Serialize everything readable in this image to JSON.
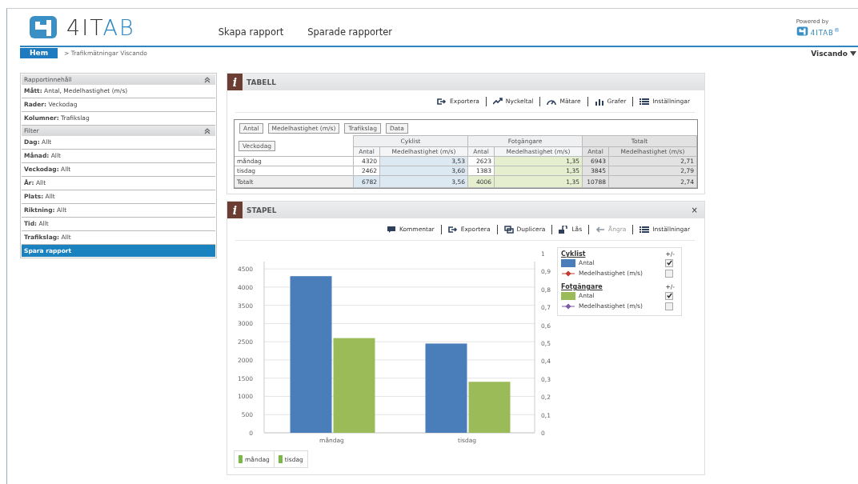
{
  "header": {
    "logo_text": [
      "4IT",
      "AB"
    ],
    "nav": [
      {
        "label": "Skapa rapport"
      },
      {
        "label": "Sparade rapporter"
      }
    ],
    "powered_by": "Powered by",
    "powered_logo": "4ITAB$^{®}$"
  },
  "breadcrumb": {
    "home": "Hem",
    "path": "> Trafikmätningar Viscando",
    "user": "Viscando"
  },
  "sidebar": {
    "sections": [
      {
        "title": "Rapportinnehåll",
        "items": [
          "**Mått:** Antal, Medelhastighet (m/s)",
          "**Rader:** Veckodag",
          "**Kolumner:** Trafikslag"
        ]
      },
      {
        "title": "Filter",
        "items": [
          "**Dag:** Allt",
          "**Månad:** Allt",
          "**Veckodag:** Allt",
          "**År:** Allt",
          "**Plats:** Allt",
          "**Riktning:** Allt",
          "**Tid:** Allt",
          "**Trafikslag:** Allt"
        ]
      }
    ],
    "save_button": "Spara rapport"
  },
  "table_panel": {
    "info_icon": "i",
    "title": "TABELL",
    "toolbar": [
      {
        "label": "Exportera",
        "kind": "export",
        "disabled": false
      },
      {
        "label": "Nyckeltal",
        "kind": "trend",
        "disabled": false
      },
      {
        "label": "Mätare",
        "kind": "gauge",
        "disabled": false
      },
      {
        "label": "Grafer",
        "kind": "bars",
        "disabled": false
      },
      {
        "label": "Inställningar",
        "kind": "list",
        "disabled": false
      }
    ],
    "chips": [
      "Antal",
      "Medelhastighet (m/s)",
      "Trafikslag",
      "Data"
    ],
    "row_chip": "Veckodag",
    "groups": [
      {
        "name": "Cyklist",
        "color": "#dce8f2",
        "columns": [
          "Antal",
          "Medelhastighet (m/s)"
        ]
      },
      {
        "name": "Fotgängare",
        "color": "#e5efcf",
        "columns": [
          "Antal",
          "Medelhastighet (m/s)"
        ]
      },
      {
        "name": "Totalt",
        "color": "#e2e2e2",
        "columns": [
          "Antal",
          "Medelhastighet (m/s)"
        ]
      }
    ],
    "rows": [
      {
        "label": "måndag",
        "kind": "data",
        "cells": [
          "4320",
          "3,53",
          "2623",
          "1,35",
          "6943",
          "2,71"
        ]
      },
      {
        "label": "tisdag",
        "kind": "data",
        "cells": [
          "2462",
          "3,60",
          "1383",
          "1,35",
          "3845",
          "2,79"
        ]
      },
      {
        "label": "Totalt",
        "kind": "total",
        "cells": [
          "6782",
          "3,56",
          "4006",
          "1,35",
          "10788",
          "2,74"
        ]
      }
    ]
  },
  "chart_panel": {
    "info_icon": "i",
    "title": "STAPEL",
    "close": "×",
    "toolbar": [
      {
        "label": "Kommentar",
        "kind": "comment",
        "disabled": false
      },
      {
        "label": "Exportera",
        "kind": "export",
        "disabled": false
      },
      {
        "label": "Duplicera",
        "kind": "duplicate",
        "disabled": false
      },
      {
        "label": "Lås",
        "kind": "lock",
        "disabled": false
      },
      {
        "label": "Ångra",
        "kind": "undo",
        "disabled": true
      },
      {
        "label": "Inställningar",
        "kind": "list",
        "disabled": false
      }
    ],
    "chart_data": {
      "type": "bar",
      "categories": [
        "måndag",
        "tisdag"
      ],
      "series": [
        {
          "name": "Antal",
          "color": "#4a7ebb",
          "values": [
            4300,
            2450
          ]
        },
        {
          "name": "Antal",
          "color": "#9bbb59",
          "values": [
            2600,
            1400
          ]
        }
      ],
      "ylim": [
        0,
        4700
      ],
      "yticks": [
        0,
        500,
        1000,
        1500,
        2000,
        2500,
        3000,
        3500,
        4000,
        4500
      ],
      "grid": true
    },
    "right_axis_labels": [
      "1",
      "0,9",
      "0,8",
      "0,7",
      "0,6",
      "0,5",
      "0,4",
      "0,3",
      "0,2",
      "0,1",
      "0"
    ],
    "legend": [
      {
        "title": "Cyklist",
        "toggle": "+/-",
        "entries": [
          {
            "kind": "bar",
            "checked": true
          },
          {
            "label": "Medelhastighet (m/s)",
            "kind": "line",
            "color": "#c0392b",
            "checked": false
          }
        ]
      },
      {
        "title": "Fotgängare",
        "toggle": "+/-",
        "entries": [
          {
            "kind": "bar",
            "checked": true
          },
          {
            "label": "Medelhastighet (m/s)",
            "kind": "line",
            "color": "#7d5ba6",
            "checked": false
          }
        ]
      }
    ],
    "category_legend": [
      "måndag",
      "tisdag"
    ]
  }
}
